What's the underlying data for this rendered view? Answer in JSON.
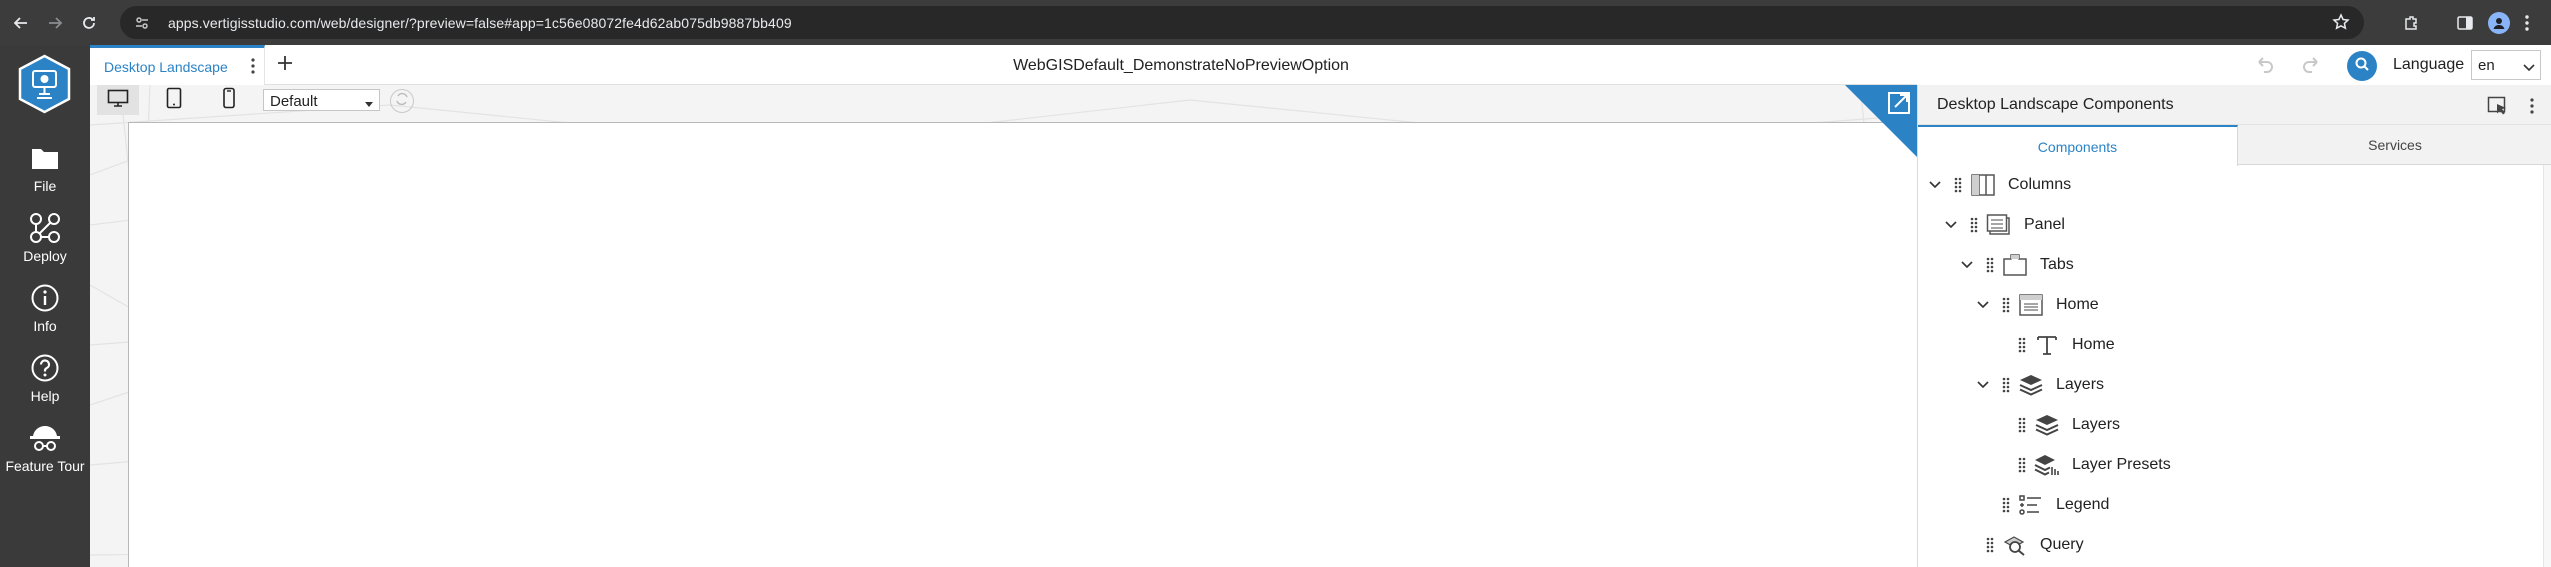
{
  "browser": {
    "url": "apps.vertigisstudio.com/web/designer/?preview=false#app=1c56e08072fe4d62ab075db9887bb409"
  },
  "rail": {
    "items": [
      {
        "label": "File",
        "icon": "folder-icon"
      },
      {
        "label": "Deploy",
        "icon": "deploy-icon"
      },
      {
        "label": "Info",
        "icon": "info-icon"
      },
      {
        "label": "Help",
        "icon": "help-icon"
      },
      {
        "label": "Feature Tour",
        "icon": "feature-tour-icon"
      }
    ]
  },
  "tabs": {
    "active_layout": "Desktop Landscape"
  },
  "app": {
    "title": "WebGISDefault_DemonstrateNoPreviewOption"
  },
  "toolbar": {
    "language_label": "Language",
    "language_value": "en"
  },
  "canvas": {
    "preset_value": "Default"
  },
  "panel": {
    "title": "Desktop Landscape Components",
    "tabs": [
      {
        "label": "Components",
        "active": true
      },
      {
        "label": "Services",
        "active": false
      }
    ],
    "tree": [
      {
        "label": "Columns",
        "icon": "columns-icon",
        "expandable": true
      },
      {
        "label": "Panel",
        "icon": "panel-icon",
        "expandable": true
      },
      {
        "label": "Tabs",
        "icon": "tabs-icon",
        "expandable": true
      },
      {
        "label": "Home",
        "icon": "home-container-icon",
        "expandable": true
      },
      {
        "label": "Home",
        "icon": "text-icon",
        "expandable": false
      },
      {
        "label": "Layers",
        "icon": "layers-icon",
        "expandable": true
      },
      {
        "label": "Layers",
        "icon": "layers-icon",
        "expandable": false
      },
      {
        "label": "Layer Presets",
        "icon": "layer-presets-icon",
        "expandable": false
      },
      {
        "label": "Legend",
        "icon": "legend-icon",
        "expandable": false
      },
      {
        "label": "Query",
        "icon": "query-icon",
        "expandable": false
      }
    ]
  },
  "colors": {
    "accent": "#2b83c6",
    "rail_bg": "#3a3a3a",
    "chrome_bg": "#3c3c3c"
  }
}
